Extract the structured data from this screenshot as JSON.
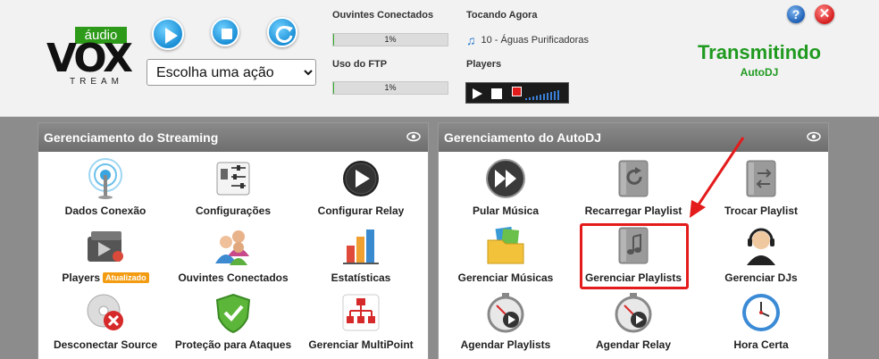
{
  "header": {
    "logo": {
      "badge": "áudio",
      "wordmark": "VOX",
      "sub": "TREAM"
    },
    "action_select": {
      "selected": "Escolha uma ação"
    },
    "listeners": {
      "label": "Ouvintes Conectados",
      "percent_text": "1%",
      "fraction": 0.01
    },
    "ftp": {
      "label": "Uso do FTP",
      "percent_text": "1%",
      "fraction": 0.01
    },
    "now_playing": {
      "label": "Tocando Agora",
      "track": "10 - Águas Purificadoras"
    },
    "players": {
      "label": "Players"
    },
    "status": {
      "title": "Transmitindo",
      "subtitle": "AutoDJ"
    },
    "icons": [
      "play-icon",
      "stop-icon",
      "refresh-icon",
      "help-icon",
      "close-icon"
    ]
  },
  "streaming_panel": {
    "title": "Gerenciamento do Streaming",
    "items": [
      {
        "label": "Dados Conexão",
        "icon": "antenna-icon"
      },
      {
        "label": "Configurações",
        "icon": "settings-icon"
      },
      {
        "label": "Configurar Relay",
        "icon": "relay-play-icon"
      },
      {
        "label": "Players",
        "icon": "player-device-icon",
        "badge": "Atualizado"
      },
      {
        "label": "Ouvintes Conectados",
        "icon": "users-icon"
      },
      {
        "label": "Estatísticas",
        "icon": "bar-chart-icon"
      },
      {
        "label": "Desconectar Source",
        "icon": "disconnect-icon"
      },
      {
        "label": "Proteção para Ataques",
        "icon": "shield-check-icon"
      },
      {
        "label": "Gerenciar MultiPoint",
        "icon": "multipoint-icon"
      }
    ]
  },
  "autodj_panel": {
    "title": "Gerenciamento do AutoDJ",
    "items": [
      {
        "label": "Pular Música",
        "icon": "skip-icon"
      },
      {
        "label": "Recarregar Playlist",
        "icon": "reload-playlist-icon"
      },
      {
        "label": "Trocar Playlist",
        "icon": "switch-playlist-icon"
      },
      {
        "label": "Gerenciar Músicas",
        "icon": "music-folder-icon"
      },
      {
        "label": "Gerenciar Playlists",
        "icon": "playlist-icon"
      },
      {
        "label": "Gerenciar DJs",
        "icon": "dj-headset-icon"
      },
      {
        "label": "Agendar Playlists",
        "icon": "schedule-playlist-icon"
      },
      {
        "label": "Agendar Relay",
        "icon": "schedule-relay-icon"
      },
      {
        "label": "Hora Certa",
        "icon": "clock-icon"
      }
    ]
  },
  "colors": {
    "accent_green": "#1f9a1f",
    "highlight_red": "#e41b1b",
    "badge_orange": "#f39c12"
  }
}
